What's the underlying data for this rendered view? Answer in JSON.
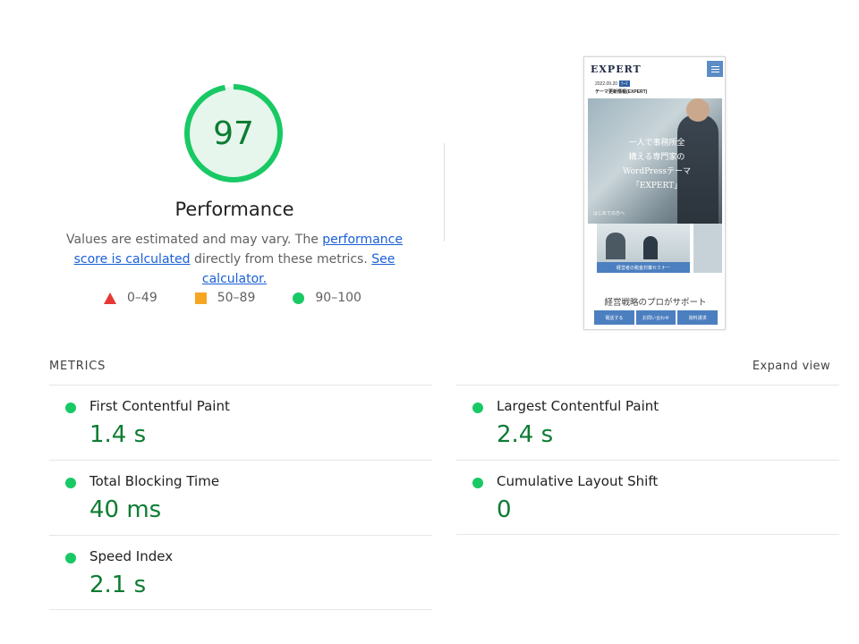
{
  "score": {
    "value": "97",
    "fraction": 0.97,
    "color": "#0c7c32",
    "ring_color": "#18c964",
    "ring_bg": "#e6f6ec"
  },
  "category": {
    "title": "Performance",
    "desc_prefix": "Values are estimated and may vary. The ",
    "link1": "performance score is calculated",
    "desc_middle": " directly from these metrics. ",
    "link2": "See calculator."
  },
  "legend": [
    {
      "icon": "red-triangle-icon",
      "range": "0–49",
      "color": "#e53935"
    },
    {
      "icon": "orange-square-icon",
      "range": "50–89",
      "color": "#f6a623"
    },
    {
      "icon": "green-circle-icon",
      "range": "90–100",
      "color": "#18c964"
    }
  ],
  "screenshot": {
    "logo": "EXPERT",
    "date": "2022.09.20",
    "tag": "ﾃｰﾏ",
    "news": "テーマ更新情報(EXPERT)",
    "hero_lines": [
      "一人で事務所全",
      "構える専門家の",
      "WordPressテーマ",
      "「EXPERT」"
    ],
    "hero_caption": "はじめての方へ",
    "card_label": "経営者の税金対策セミナー",
    "tagline": "経営戦略のプロがサポート",
    "buttons": [
      "電話する",
      "お問い合わせ",
      "資料請求"
    ]
  },
  "metrics": {
    "title": "METRICS",
    "expand": "Expand view",
    "items": [
      {
        "label": "First Contentful Paint",
        "value": "1.4 s"
      },
      {
        "label": "Largest Contentful Paint",
        "value": "2.4 s"
      },
      {
        "label": "Total Blocking Time",
        "value": "40 ms"
      },
      {
        "label": "Cumulative Layout Shift",
        "value": "0"
      },
      {
        "label": "Speed Index",
        "value": "2.1 s"
      }
    ]
  }
}
